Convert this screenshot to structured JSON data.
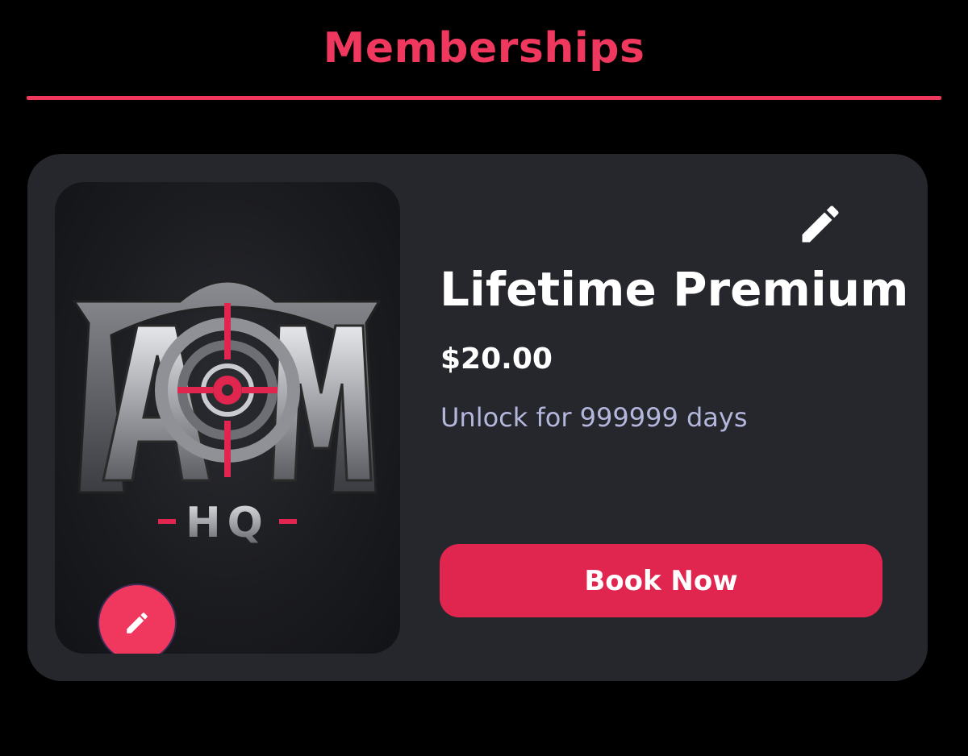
{
  "page": {
    "title": "Memberships"
  },
  "membership": {
    "name": "Lifetime Premium",
    "price": "$20.00",
    "duration": "Unlock for 999999 days",
    "book_label": "Book Now",
    "image": {
      "logo_text": "AIM",
      "logo_subtext": "HQ"
    }
  },
  "icons": {
    "card_edit": "pencil-icon",
    "image_edit": "pencil-icon"
  },
  "colors": {
    "accent": "#f0385f",
    "button": "#e0254f",
    "card_background": "#25272d",
    "page_background": "#000000",
    "subtext": "#b4b7dc"
  }
}
